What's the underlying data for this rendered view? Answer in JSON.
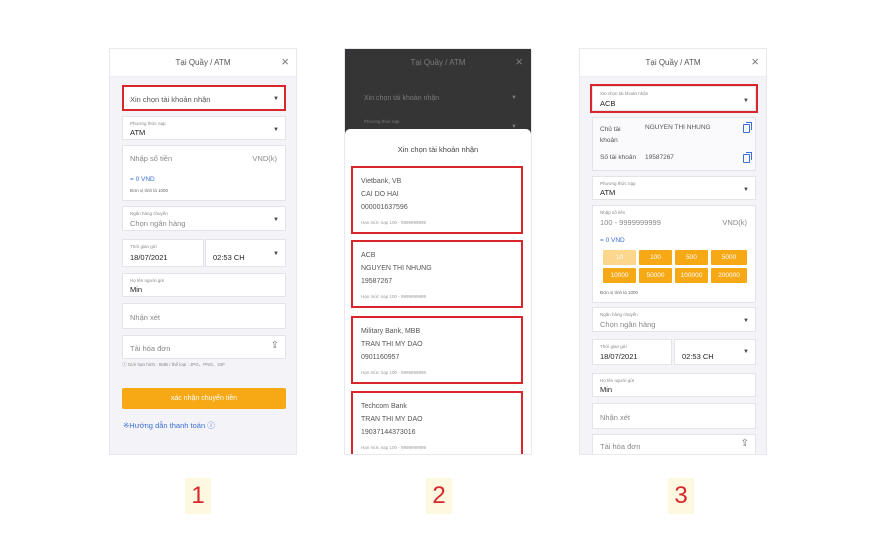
{
  "common": {
    "title": "Tại Quầy / ATM",
    "close_glyph": "×",
    "select_account": "Xin chọn tài khoản nhận",
    "method_label": "Phương thức nạp",
    "method_value": "ATM",
    "amount_placeholder": "Nhập số tiền",
    "amount_label": "Nhập số tiền",
    "amount_range": "100 - 9999999999",
    "unit": "VND(k)",
    "zero_vnd": "= 0 VND",
    "unit_note": "Đơn vị tính là 1000",
    "bank_label": "Ngân hàng chuyển",
    "bank_placeholder": "Chọn ngân hàng",
    "time_label": "Thời gian gửi",
    "date_value": "18/07/2021",
    "time_value": "02:53 CH",
    "name_label": "Họ tên người gửi",
    "name_value": "Min",
    "comment_placeholder": "Nhận xét",
    "upload_placeholder": "Tải hóa đơn",
    "upload_note": "ⓘ Giới hạn hình : 5MB / thể loại : JPG、PNG、GIF",
    "confirm_button": "xác nhận chuyển tiền",
    "guide_link": "※Hướng dẫn thanh toán ⓘ"
  },
  "sheet": {
    "title": "Xin chọn tài khoản nhận",
    "limit": "Hạn mức nạp 100 - 9999999999",
    "accounts": [
      {
        "bank": "Vietbank, VB",
        "holder": "CAI DO HAI",
        "number": "000001637596"
      },
      {
        "bank": "ACB",
        "holder": "NGUYEN THI NHUNG",
        "number": "19587267"
      },
      {
        "bank": "Military Bank, MBB",
        "holder": "TRAN THI MY DAO",
        "number": "0901160957"
      },
      {
        "bank": "Techcom Bank",
        "holder": "TRAN THI MY DAO",
        "number": "19037144373016"
      }
    ]
  },
  "phone3": {
    "selected_bank": "ACB",
    "holder_label": "Chủ tài khoản",
    "holder_value": "NGUYEN THI NHUNG",
    "number_label": "Số tài khoản",
    "number_value": "19587267",
    "quick_amounts": [
      "10",
      "100",
      "500",
      "5000",
      "10000",
      "50000",
      "100000",
      "200000"
    ]
  },
  "steps": [
    "1",
    "2",
    "3"
  ],
  "colors": {
    "highlight": "#d9262c",
    "accent": "#f6a815",
    "link": "#3b6fd4"
  }
}
